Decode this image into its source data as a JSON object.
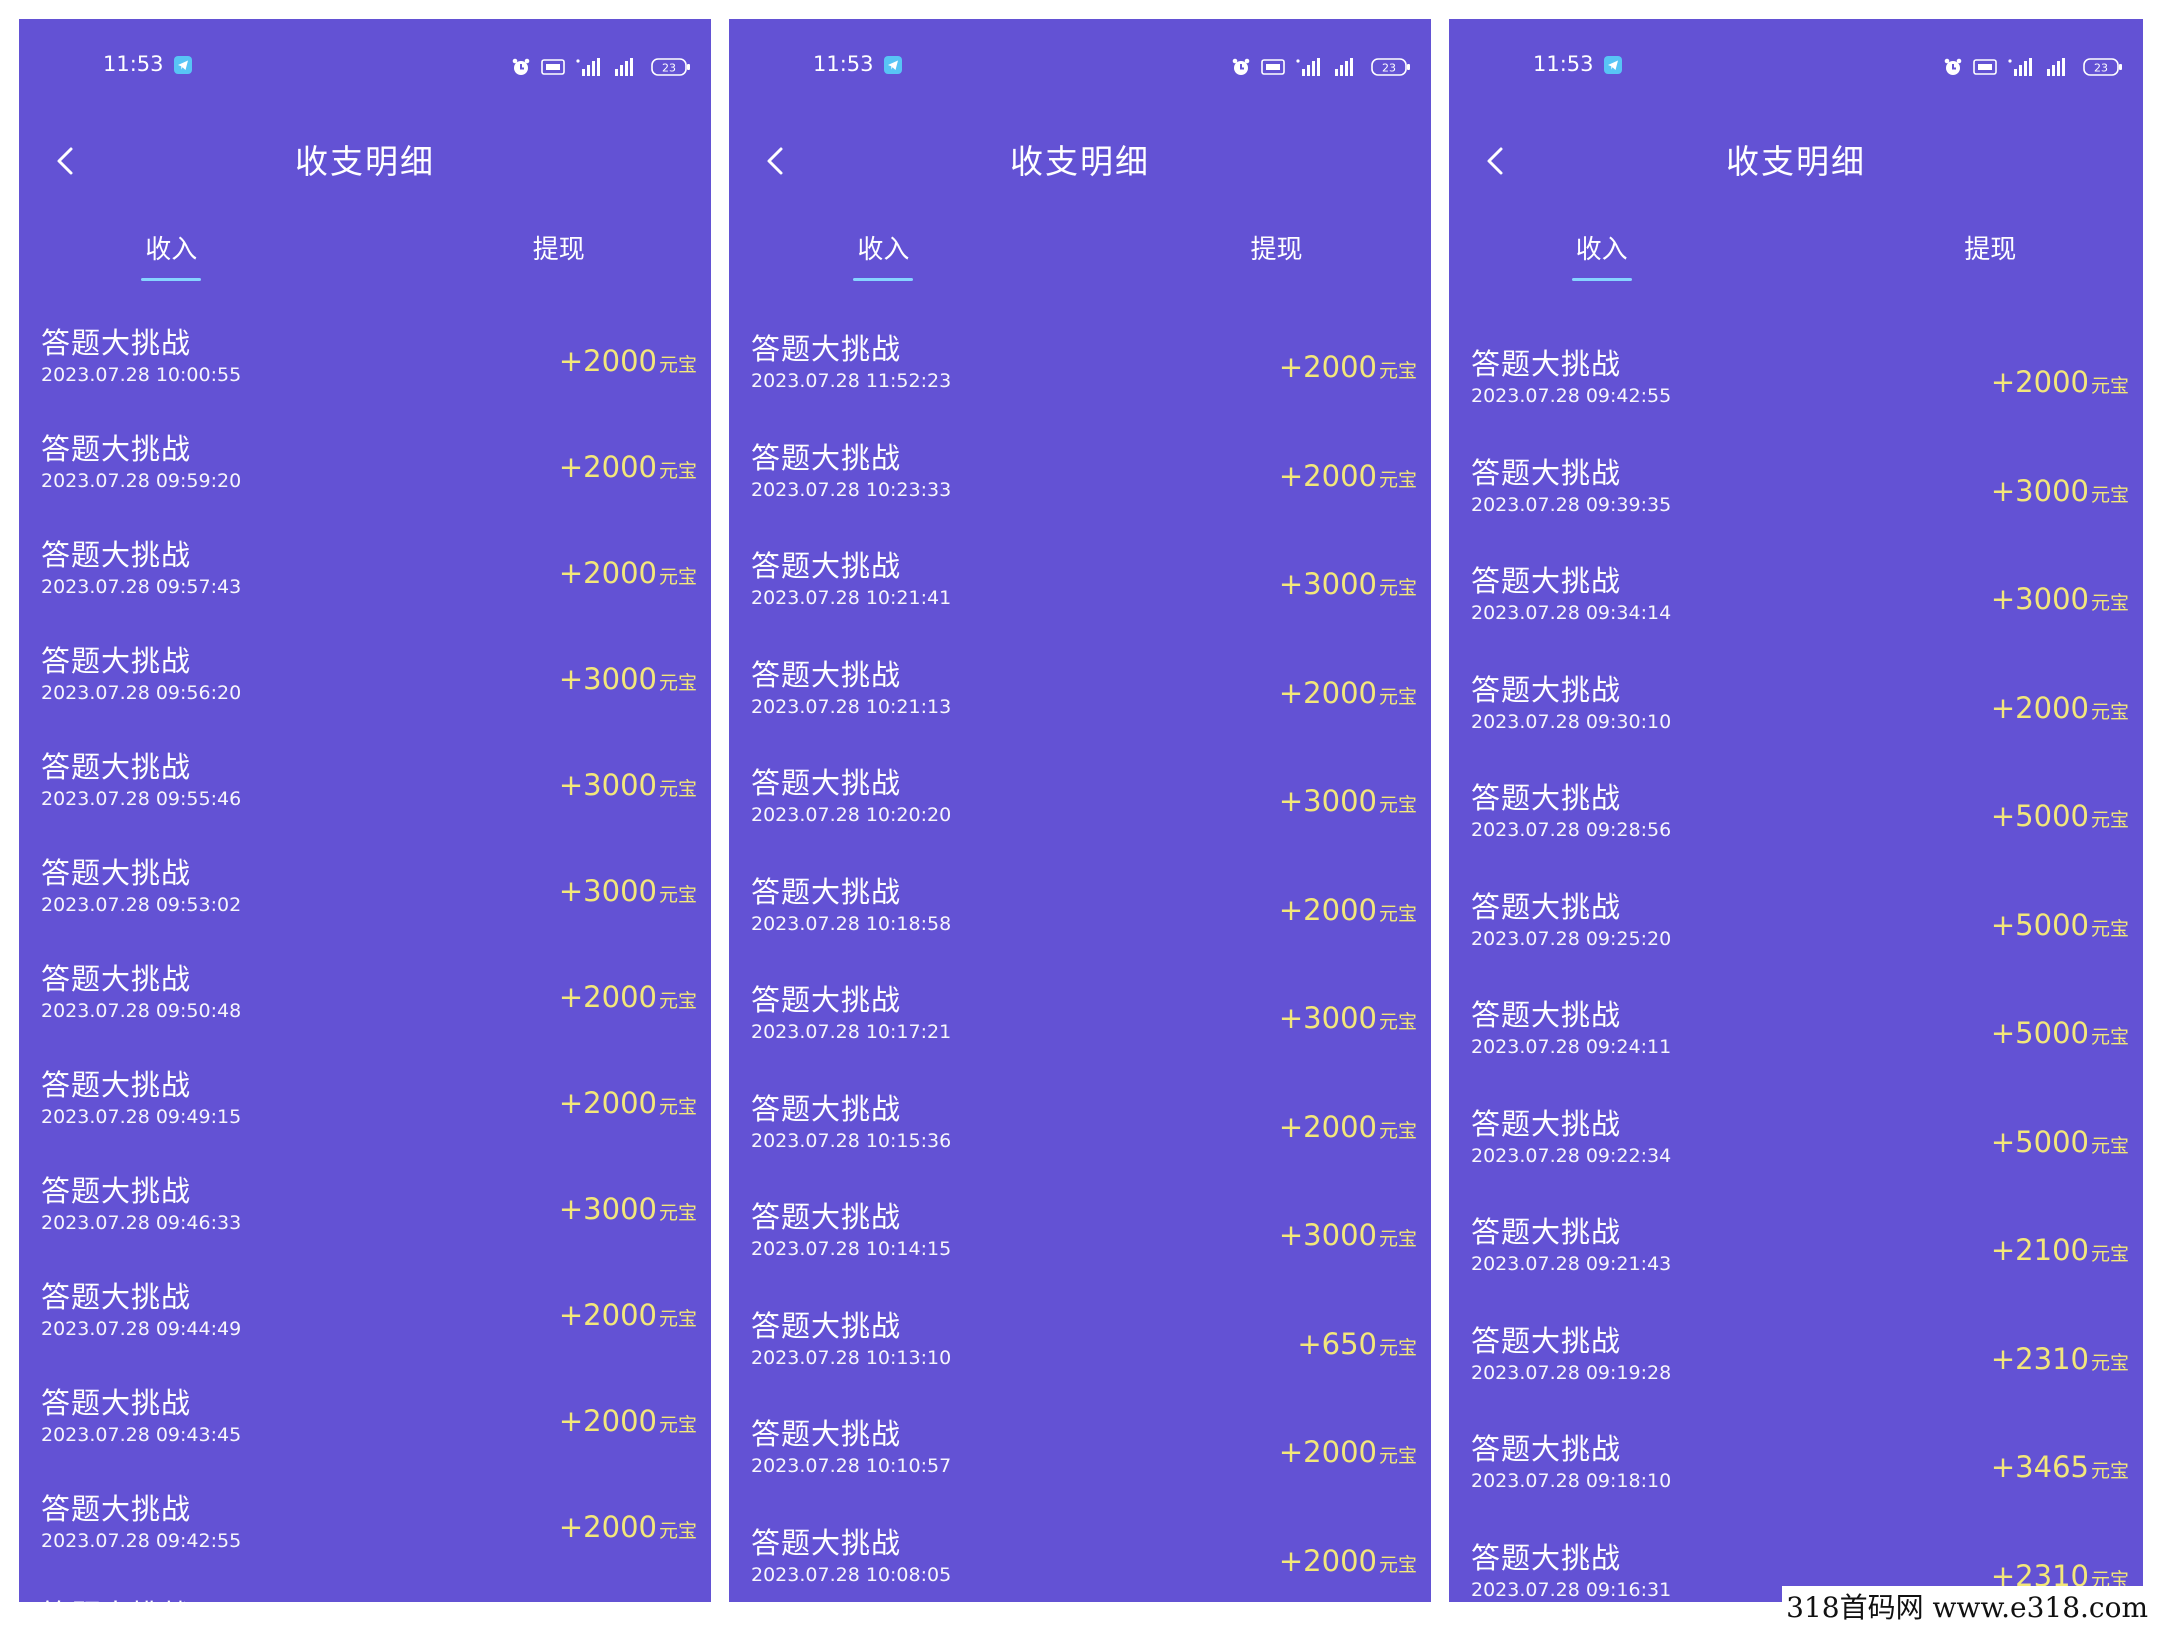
{
  "colors": {
    "background": "#6352d4",
    "amount": "#f3e77a",
    "tab_indicator": "#86d4ff",
    "text": "#ffffff"
  },
  "panels": [
    {
      "status": {
        "time": "11:53",
        "battery": "23"
      },
      "nav": {
        "title": "收支明细"
      },
      "tabs": [
        {
          "label": "收入",
          "active": true
        },
        {
          "label": "提现",
          "active": false
        }
      ],
      "unit": "元宝",
      "records": [
        {
          "title": "答题大挑战",
          "time": "2023.07.28 10:00:55",
          "amount": "+2000"
        },
        {
          "title": "答题大挑战",
          "time": "2023.07.28 09:59:20",
          "amount": "+2000"
        },
        {
          "title": "答题大挑战",
          "time": "2023.07.28 09:57:43",
          "amount": "+2000"
        },
        {
          "title": "答题大挑战",
          "time": "2023.07.28 09:56:20",
          "amount": "+3000"
        },
        {
          "title": "答题大挑战",
          "time": "2023.07.28 09:55:46",
          "amount": "+3000"
        },
        {
          "title": "答题大挑战",
          "time": "2023.07.28 09:53:02",
          "amount": "+3000"
        },
        {
          "title": "答题大挑战",
          "time": "2023.07.28 09:50:48",
          "amount": "+2000"
        },
        {
          "title": "答题大挑战",
          "time": "2023.07.28 09:49:15",
          "amount": "+2000"
        },
        {
          "title": "答题大挑战",
          "time": "2023.07.28 09:46:33",
          "amount": "+3000"
        },
        {
          "title": "答题大挑战",
          "time": "2023.07.28 09:44:49",
          "amount": "+2000"
        },
        {
          "title": "答题大挑战",
          "time": "2023.07.28 09:43:45",
          "amount": "+2000"
        },
        {
          "title": "答题大挑战",
          "time": "2023.07.28 09:42:55",
          "amount": "+2000"
        },
        {
          "title": "答题大挑战",
          "time": "",
          "amount": ""
        }
      ]
    },
    {
      "status": {
        "time": "11:53",
        "battery": "23"
      },
      "nav": {
        "title": "收支明细"
      },
      "tabs": [
        {
          "label": "收入",
          "active": true
        },
        {
          "label": "提现",
          "active": false
        }
      ],
      "unit": "元宝",
      "records": [
        {
          "title": "答题大挑战",
          "time": "2023.07.28 11:52:23",
          "amount": "+2000"
        },
        {
          "title": "答题大挑战",
          "time": "2023.07.28 10:23:33",
          "amount": "+2000"
        },
        {
          "title": "答题大挑战",
          "time": "2023.07.28 10:21:41",
          "amount": "+3000"
        },
        {
          "title": "答题大挑战",
          "time": "2023.07.28 10:21:13",
          "amount": "+2000"
        },
        {
          "title": "答题大挑战",
          "time": "2023.07.28 10:20:20",
          "amount": "+3000"
        },
        {
          "title": "答题大挑战",
          "time": "2023.07.28 10:18:58",
          "amount": "+2000"
        },
        {
          "title": "答题大挑战",
          "time": "2023.07.28 10:17:21",
          "amount": "+3000"
        },
        {
          "title": "答题大挑战",
          "time": "2023.07.28 10:15:36",
          "amount": "+2000"
        },
        {
          "title": "答题大挑战",
          "time": "2023.07.28 10:14:15",
          "amount": "+3000"
        },
        {
          "title": "答题大挑战",
          "time": "2023.07.28 10:13:10",
          "amount": "+650"
        },
        {
          "title": "答题大挑战",
          "time": "2023.07.28 10:10:57",
          "amount": "+2000"
        },
        {
          "title": "答题大挑战",
          "time": "2023.07.28 10:08:05",
          "amount": "+2000"
        }
      ]
    },
    {
      "status": {
        "time": "11:53",
        "battery": "23"
      },
      "nav": {
        "title": "收支明细"
      },
      "tabs": [
        {
          "label": "收入",
          "active": true
        },
        {
          "label": "提现",
          "active": false
        }
      ],
      "unit": "元宝",
      "records": [
        {
          "title": "答题大挑战",
          "time": "2023.07.28 09:42:55",
          "amount": "+2000"
        },
        {
          "title": "答题大挑战",
          "time": "2023.07.28 09:39:35",
          "amount": "+3000"
        },
        {
          "title": "答题大挑战",
          "time": "2023.07.28 09:34:14",
          "amount": "+3000"
        },
        {
          "title": "答题大挑战",
          "time": "2023.07.28 09:30:10",
          "amount": "+2000"
        },
        {
          "title": "答题大挑战",
          "time": "2023.07.28 09:28:56",
          "amount": "+5000"
        },
        {
          "title": "答题大挑战",
          "time": "2023.07.28 09:25:20",
          "amount": "+5000"
        },
        {
          "title": "答题大挑战",
          "time": "2023.07.28 09:24:11",
          "amount": "+5000"
        },
        {
          "title": "答题大挑战",
          "time": "2023.07.28 09:22:34",
          "amount": "+5000"
        },
        {
          "title": "答题大挑战",
          "time": "2023.07.28 09:21:43",
          "amount": "+2100"
        },
        {
          "title": "答题大挑战",
          "time": "2023.07.28 09:19:28",
          "amount": "+2310"
        },
        {
          "title": "答题大挑战",
          "time": "2023.07.28 09:18:10",
          "amount": "+3465"
        },
        {
          "title": "答题大挑战",
          "time": "2023.07.28 09:16:31",
          "amount": "+2310"
        }
      ]
    }
  ],
  "watermark": "318首码网  www.e318.com"
}
